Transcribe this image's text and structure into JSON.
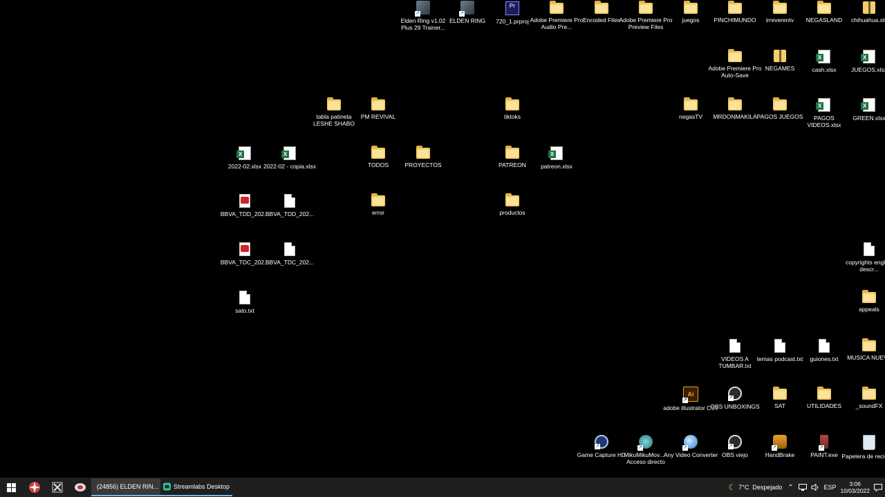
{
  "desktop": {
    "icons": [
      {
        "label": "Elden Ring v1.02 Plus 29 Trainer...",
        "type": "app",
        "name": "elden-ring-trainer"
      },
      {
        "label": "ELDEN RING",
        "type": "app",
        "name": "elden-ring"
      },
      {
        "label": "720_1.prproj",
        "type": "prproj",
        "name": "prproj-720"
      },
      {
        "label": "Adobe Premiere Pro Audio Pre...",
        "type": "folder",
        "name": "premiere-audio-preview"
      },
      {
        "label": "Encoded Files",
        "type": "folder",
        "name": "encoded-files"
      },
      {
        "label": "Adobe Premiere Pro Preview Files",
        "type": "folder",
        "name": "premiere-preview-files"
      },
      {
        "label": "juegos",
        "type": "folder",
        "name": "juegos"
      },
      {
        "label": "PINCHIMUNDO",
        "type": "folder",
        "name": "pinchimundo"
      },
      {
        "label": "irreverentv",
        "type": "folder",
        "name": "irreverentv"
      },
      {
        "label": "NEGASLAND",
        "type": "folder",
        "name": "negasland"
      },
      {
        "label": "chihuahua.xls",
        "type": "zip",
        "name": "chihuahua"
      },
      {
        "label": "Adobe Premiere Pro Auto-Save",
        "type": "folder",
        "name": "premiere-autosave"
      },
      {
        "label": "NEGAMES",
        "type": "zip",
        "name": "negames"
      },
      {
        "label": "cash.xlsx",
        "type": "xlsx",
        "name": "cash-xlsx"
      },
      {
        "label": "JUEGOS.xlsx",
        "type": "xlsx",
        "name": "juegos-xlsx"
      },
      {
        "label": "tabla patineta LESHE SHABO",
        "type": "folder",
        "name": "tabla-patineta"
      },
      {
        "label": "PM REVIVAL",
        "type": "folder",
        "name": "pm-revival"
      },
      {
        "label": "tiktoks",
        "type": "folder",
        "name": "tiktoks"
      },
      {
        "label": "negasTV",
        "type": "folder",
        "name": "negastv"
      },
      {
        "label": "MRDONMAKILA",
        "type": "folder",
        "name": "mrdonmakila"
      },
      {
        "label": "PAGOS JUEGOS",
        "type": "folder",
        "name": "pagos-juegos"
      },
      {
        "label": "PAGOS VIDEOS.xlsx",
        "type": "xlsx",
        "name": "pagos-videos"
      },
      {
        "label": "GREEN.xlsx",
        "type": "xlsx",
        "name": "green-xlsx"
      },
      {
        "label": "2022-02.xlsx",
        "type": "xlsx",
        "name": "xlsx-2022-02"
      },
      {
        "label": "2022-02 - copia.xlsx",
        "type": "xlsx",
        "name": "xlsx-2022-02-copia"
      },
      {
        "label": "TODOS",
        "type": "folder",
        "name": "todos"
      },
      {
        "label": "PROYECTOS",
        "type": "folder",
        "name": "proyectos"
      },
      {
        "label": "PATREON",
        "type": "folder",
        "name": "patreon-folder"
      },
      {
        "label": "patreon.xlsx",
        "type": "xlsx",
        "name": "patreon-xlsx"
      },
      {
        "label": "BBVA_TDD_202...",
        "type": "pdf",
        "name": "bbva-tdd-pdf"
      },
      {
        "label": "BBVA_TDD_202...",
        "type": "doc",
        "name": "bbva-tdd-doc"
      },
      {
        "label": "error",
        "type": "folder",
        "name": "error"
      },
      {
        "label": "productos",
        "type": "folder",
        "name": "productos"
      },
      {
        "label": "BBVA_TDC_202...",
        "type": "pdf",
        "name": "bbva-tdc-pdf"
      },
      {
        "label": "BBVA_TDC_202...",
        "type": "doc",
        "name": "bbva-tdc-doc"
      },
      {
        "label": "copyrights english descr...",
        "type": "doc",
        "name": "copyrights"
      },
      {
        "label": "sato.txt",
        "type": "doc",
        "name": "sato-txt"
      },
      {
        "label": "appeals",
        "type": "folder",
        "name": "appeals"
      },
      {
        "label": "VIDEOS A TUMBAR.txt",
        "type": "doc",
        "name": "videos-a-tumbar"
      },
      {
        "label": "temas podcast.txt",
        "type": "doc",
        "name": "temas-podcast"
      },
      {
        "label": "guiones.txt",
        "type": "doc",
        "name": "guiones"
      },
      {
        "label": "MUSICA NUEVA",
        "type": "folder",
        "name": "musica-nueva"
      },
      {
        "label": "adobe illustrator CS6",
        "type": "app-ai",
        "name": "illustrator"
      },
      {
        "label": "OBS UNBOXINGS",
        "type": "app-obs",
        "name": "obs-unboxings"
      },
      {
        "label": "SAT",
        "type": "folder",
        "name": "sat"
      },
      {
        "label": "UTILIDADES",
        "type": "folder",
        "name": "utilidades"
      },
      {
        "label": "_soundFX",
        "type": "folder",
        "name": "soundfx"
      },
      {
        "label": "Game Capture HD",
        "type": "app-gc",
        "name": "game-capture"
      },
      {
        "label": "MikuMikuMov... - Acceso directo",
        "type": "app-miku",
        "name": "mikumiku"
      },
      {
        "label": "Any Video Converter",
        "type": "app-avc",
        "name": "any-video-converter"
      },
      {
        "label": "OBS viejo",
        "type": "app-obs",
        "name": "obs-viejo"
      },
      {
        "label": "HandBrake",
        "type": "app-hb",
        "name": "handbrake"
      },
      {
        "label": "PAINT.exe",
        "type": "app-paint",
        "name": "paint"
      },
      {
        "label": "Papelera de reciclaje",
        "type": "recycle",
        "name": "recycle-bin"
      }
    ]
  },
  "taskbar": {
    "tasks": [
      {
        "label": "(24856) ELDEN RIN...",
        "icon": "chrome-icon"
      },
      {
        "label": "Streamlabs Desktop",
        "icon": "streamlabs-icon"
      }
    ],
    "weather": "7°C  Despejado",
    "language": "ESP",
    "time": "3:06",
    "date": "10/03/2022"
  }
}
